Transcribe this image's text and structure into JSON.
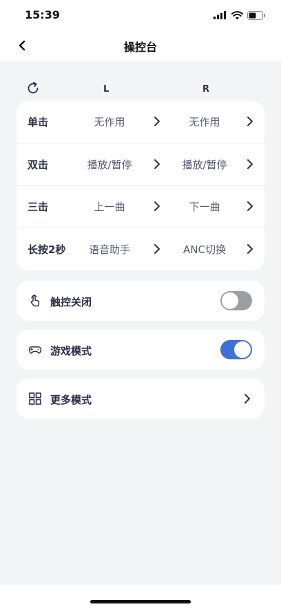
{
  "status": {
    "time": "15:39"
  },
  "nav": {
    "title": "操控台"
  },
  "columns": {
    "left": "L",
    "right": "R"
  },
  "gestures": [
    {
      "label": "单击",
      "left": "无作用",
      "right": "无作用"
    },
    {
      "label": "双击",
      "left": "播放/暂停",
      "right": "播放/暂停"
    },
    {
      "label": "三击",
      "left": "上一曲",
      "right": "下一曲"
    },
    {
      "label": "长按2秒",
      "left": "语音助手",
      "right": "ANC切换"
    }
  ],
  "settings": {
    "touch_off": {
      "label": "触控关闭",
      "enabled": false,
      "icon": "touch-icon"
    },
    "game_mode": {
      "label": "游戏模式",
      "enabled": true,
      "icon": "gamepad-icon"
    },
    "more_modes": {
      "label": "更多模式",
      "icon": "grid-icon"
    }
  },
  "colors": {
    "accent": "#3f71d6",
    "switch_off": "#9c9ea3",
    "text": "#2b2e4a",
    "background": "#f3f4f6"
  }
}
